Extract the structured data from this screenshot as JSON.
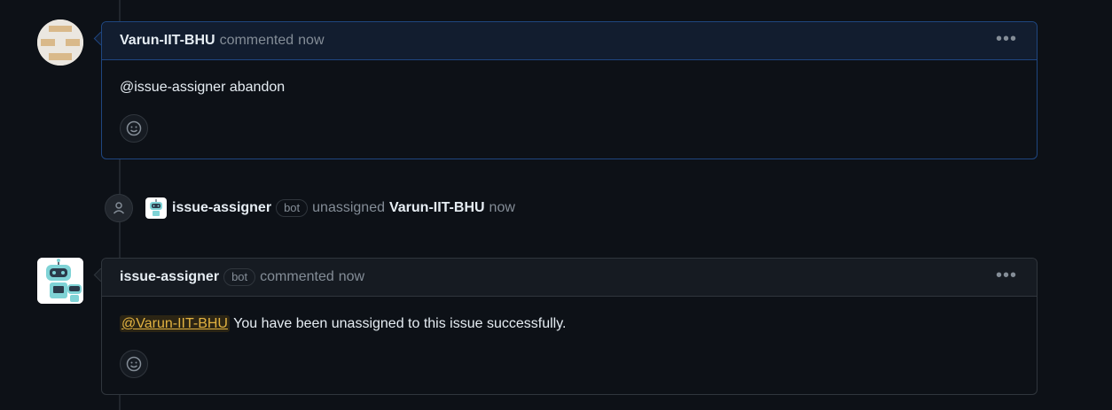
{
  "timeline": {
    "comment1": {
      "author": "Varun-IIT-BHU",
      "action": "commented",
      "time": "now",
      "body": "@issue-assigner abandon",
      "menu_icon": "kebab-horizontal-icon",
      "reaction_icon": "smiley-icon"
    },
    "event": {
      "icon": "person-icon",
      "actor": "issue-assigner",
      "badge": "bot",
      "action": "unassigned",
      "target": "Varun-IIT-BHU",
      "time": "now"
    },
    "comment2": {
      "author": "issue-assigner",
      "badge": "bot",
      "action": "commented",
      "time": "now",
      "mention": "@Varun-IIT-BHU",
      "body": "You have been unassigned to this issue successfully.",
      "menu_icon": "kebab-horizontal-icon",
      "reaction_icon": "smiley-icon"
    }
  },
  "colors": {
    "background": "#0d1117",
    "highlight_border": "#1f4680",
    "mention": "#e3b341",
    "muted_text": "#848d97"
  }
}
